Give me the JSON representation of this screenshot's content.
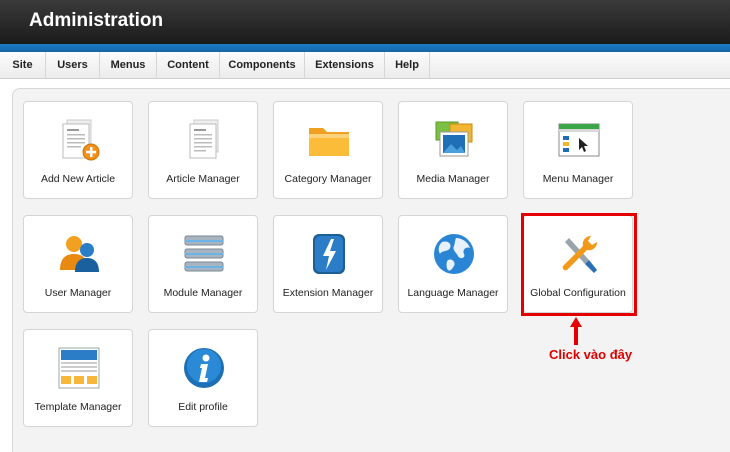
{
  "header": {
    "title": "Administration"
  },
  "menu": {
    "items": [
      {
        "label": "Site"
      },
      {
        "label": "Users"
      },
      {
        "label": "Menus"
      },
      {
        "label": "Content"
      },
      {
        "label": "Components"
      },
      {
        "label": "Extensions"
      },
      {
        "label": "Help"
      }
    ]
  },
  "tiles": [
    {
      "label": "Add New Article",
      "icon": "add-article-icon"
    },
    {
      "label": "Article Manager",
      "icon": "article-manager-icon"
    },
    {
      "label": "Category Manager",
      "icon": "folder-icon"
    },
    {
      "label": "Media Manager",
      "icon": "media-icon"
    },
    {
      "label": "Menu Manager",
      "icon": "menu-manager-icon"
    },
    {
      "label": "User Manager",
      "icon": "users-icon"
    },
    {
      "label": "Module Manager",
      "icon": "modules-icon"
    },
    {
      "label": "Extension Manager",
      "icon": "extension-icon"
    },
    {
      "label": "Language Manager",
      "icon": "globe-icon"
    },
    {
      "label": "Global Configuration",
      "icon": "tools-icon"
    },
    {
      "label": "Template Manager",
      "icon": "template-icon"
    },
    {
      "label": "Edit profile",
      "icon": "info-icon"
    }
  ],
  "annotation": {
    "text": "Click vào đây",
    "color": "#e40000"
  },
  "colors": {
    "header": "#222222",
    "accent_bar": "#1a7dc4",
    "panel": "#f3f3f3"
  }
}
